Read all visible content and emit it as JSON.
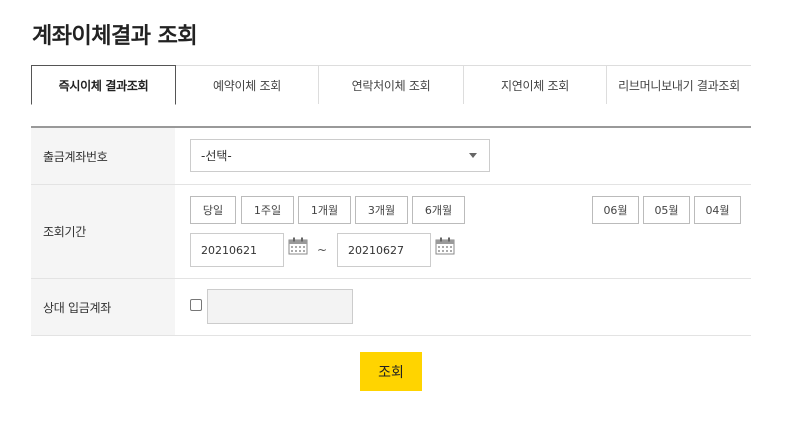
{
  "page": {
    "title": "계좌이체결과 조회"
  },
  "tabs": [
    {
      "label": "즉시이체 결과조회",
      "active": true
    },
    {
      "label": "예약이체 조회"
    },
    {
      "label": "연락처이체 조회"
    },
    {
      "label": "지연이체 조회"
    },
    {
      "label": "리브머니보내기 결과조회"
    }
  ],
  "form": {
    "account": {
      "label": "출금계좌번호",
      "selected": "-선택-"
    },
    "period": {
      "label": "조회기간",
      "quick": [
        "당일",
        "1주일",
        "1개월",
        "3개월",
        "6개월"
      ],
      "months": [
        "06월",
        "05월",
        "04월"
      ],
      "from": "20210621",
      "to": "20210627",
      "separator": "~"
    },
    "counterparty": {
      "label": "상대 입금계좌",
      "value": ""
    }
  },
  "actions": {
    "search": "조회"
  },
  "colors": {
    "accent": "#ffd400",
    "label_bg": "#f5f5f5"
  }
}
